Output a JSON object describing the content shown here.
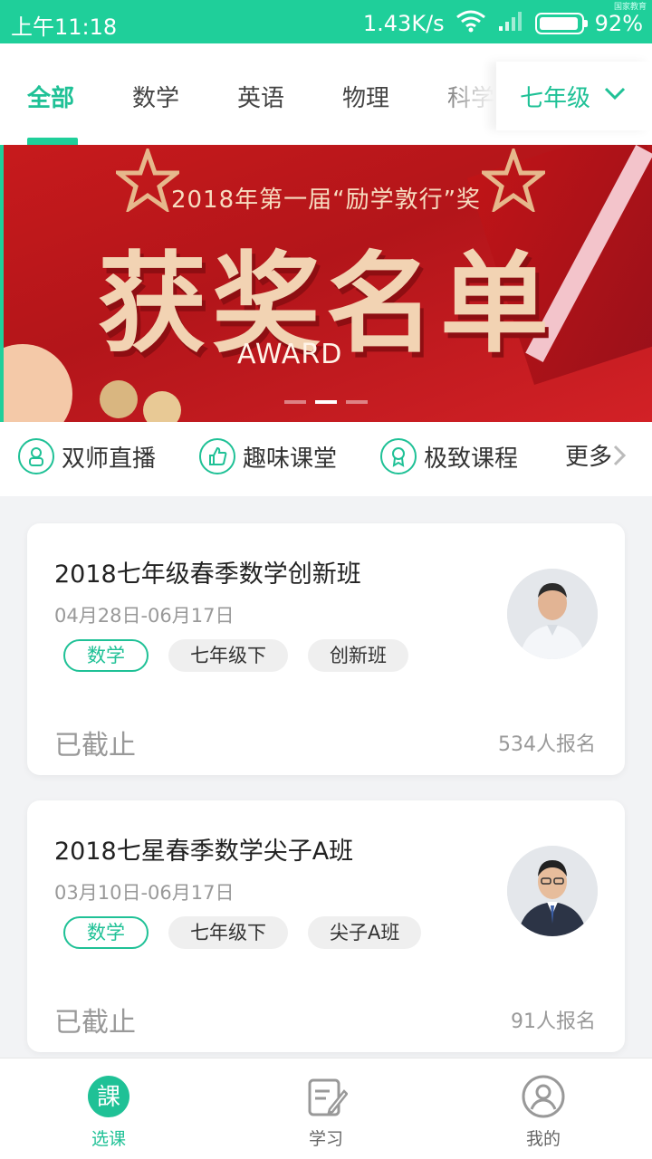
{
  "status_bar": {
    "time": "上午11:18",
    "speed": "1.43K/s",
    "battery": "92%",
    "corner_text": "国家教育"
  },
  "tabs": [
    {
      "label": "全部",
      "active": true
    },
    {
      "label": "数学",
      "active": false
    },
    {
      "label": "英语",
      "active": false
    },
    {
      "label": "物理",
      "active": false
    },
    {
      "label": "科学",
      "active": false
    }
  ],
  "grade_selector": {
    "label": "七年级"
  },
  "banner": {
    "subtitle": "2018年第一届“励学敦行”奖",
    "title": "获奖名单",
    "award": "AWARD",
    "dots_total": 3,
    "dots_active_index": 1
  },
  "categories": [
    {
      "label": "双师直播",
      "icon": "people-icon"
    },
    {
      "label": "趣味课堂",
      "icon": "thumbs-up-icon"
    },
    {
      "label": "极致课程",
      "icon": "medal-icon"
    },
    {
      "label": "更多",
      "icon": "chevron-right-icon"
    }
  ],
  "courses": [
    {
      "title": "2018七年级春季数学创新班",
      "date": "04月28日-06月17日",
      "tags": [
        "数学",
        "七年级下",
        "创新班"
      ],
      "status": "已截止",
      "enrolled": "534人报名"
    },
    {
      "title": "2018七星春季数学尖子A班",
      "date": "03月10日-06月17日",
      "tags": [
        "数学",
        "七年级下",
        "尖子A班"
      ],
      "status": "已截止",
      "enrolled": "91人报名"
    }
  ],
  "bottom_nav": [
    {
      "label": "选课",
      "icon_text": "課",
      "active": true
    },
    {
      "label": "学习",
      "active": false
    },
    {
      "label": "我的",
      "active": false
    }
  ],
  "colors": {
    "accent": "#1fc196",
    "status_bar": "#1fcf9a",
    "banner_red": "#c71a1c"
  }
}
